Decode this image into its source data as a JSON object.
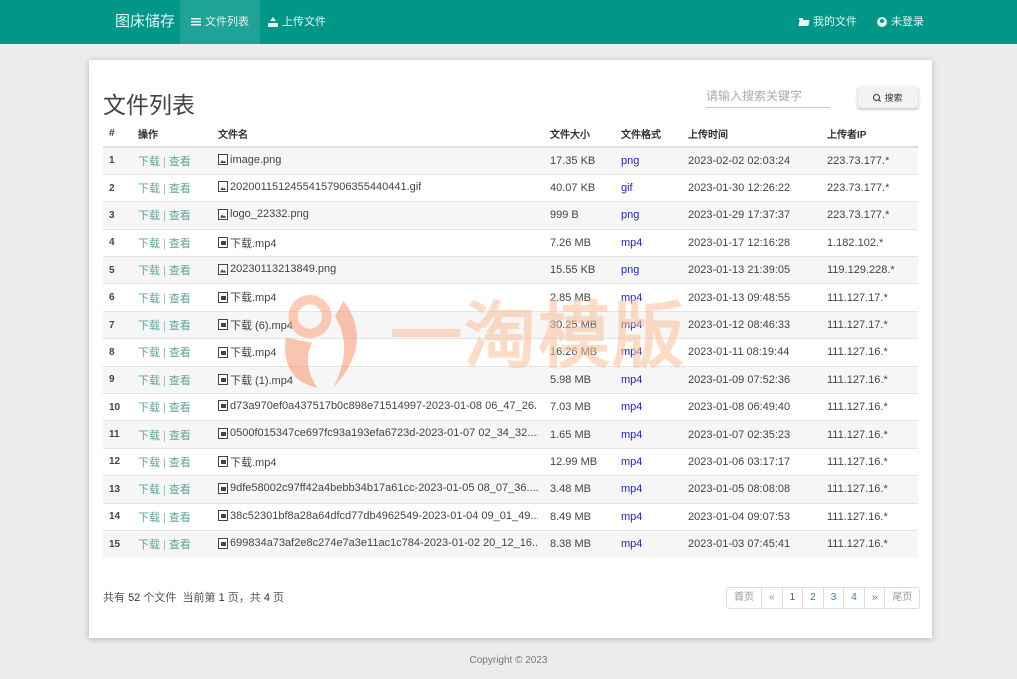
{
  "nav": {
    "brand": "图床储存",
    "items": [
      {
        "label": "文件列表",
        "icon": "list-icon",
        "active": true
      },
      {
        "label": "上传文件",
        "icon": "upload-icon",
        "active": false
      }
    ],
    "right": [
      {
        "label": "我的文件",
        "icon": "folder-open-icon"
      },
      {
        "label": "未登录",
        "icon": "user-circle-icon"
      }
    ]
  },
  "page": {
    "title": "文件列表",
    "search_placeholder": "请输入搜索关键字",
    "search_value": "",
    "search_button": "搜索"
  },
  "table": {
    "headers": [
      "#",
      "操作",
      "文件名",
      "文件大小",
      "文件格式",
      "上传时间",
      "上传者IP"
    ],
    "action_download": "下载",
    "action_separator": "|",
    "action_view": "查看",
    "rows": [
      {
        "n": "1",
        "name": "image.png",
        "kind": "image",
        "size": "17.35 KB",
        "fmt": "png",
        "time": "2023-02-02 02:03:24",
        "ip": "223.73.177.*"
      },
      {
        "n": "2",
        "name": "20200115124554157906355440441.gif",
        "kind": "image",
        "size": "40.07 KB",
        "fmt": "gif",
        "time": "2023-01-30 12:26:22",
        "ip": "223.73.177.*"
      },
      {
        "n": "3",
        "name": "logo_22332.png",
        "kind": "image",
        "size": "999 B",
        "fmt": "png",
        "time": "2023-01-29 17:37:37",
        "ip": "223.73.177.*"
      },
      {
        "n": "4",
        "name": "下载.mp4",
        "kind": "video",
        "size": "7.26 MB",
        "fmt": "mp4",
        "time": "2023-01-17 12:16:28",
        "ip": "1.182.102.*"
      },
      {
        "n": "5",
        "name": "20230113213849.png",
        "kind": "image",
        "size": "15.55 KB",
        "fmt": "png",
        "time": "2023-01-13 21:39:05",
        "ip": "119.129.228.*"
      },
      {
        "n": "6",
        "name": "下载.mp4",
        "kind": "video",
        "size": "2.85 MB",
        "fmt": "mp4",
        "time": "2023-01-13 09:48:55",
        "ip": "111.127.17.*"
      },
      {
        "n": "7",
        "name": "下载 (6).mp4",
        "kind": "video",
        "size": "30.25 MB",
        "fmt": "mp4",
        "time": "2023-01-12 08:46:33",
        "ip": "111.127.17.*"
      },
      {
        "n": "8",
        "name": "下载.mp4",
        "kind": "video",
        "size": "16.26 MB",
        "fmt": "mp4",
        "time": "2023-01-11 08:19:44",
        "ip": "111.127.16.*"
      },
      {
        "n": "9",
        "name": "下载 (1).mp4",
        "kind": "video",
        "size": "5.98 MB",
        "fmt": "mp4",
        "time": "2023-01-09 07:52:36",
        "ip": "111.127.16.*"
      },
      {
        "n": "10",
        "name": "d73a970ef0a437517b0c898e71514997-2023-01-08 06_47_26....",
        "kind": "video",
        "size": "7.03 MB",
        "fmt": "mp4",
        "time": "2023-01-08 06:49:40",
        "ip": "111.127.16.*"
      },
      {
        "n": "11",
        "name": "0500f015347ce697fc93a193efa6723d-2023-01-07 02_34_32....",
        "kind": "video",
        "size": "1.65 MB",
        "fmt": "mp4",
        "time": "2023-01-07 02:35:23",
        "ip": "111.127.16.*"
      },
      {
        "n": "12",
        "name": "下载.mp4",
        "kind": "video",
        "size": "12.99 MB",
        "fmt": "mp4",
        "time": "2023-01-06 03:17:17",
        "ip": "111.127.16.*"
      },
      {
        "n": "13",
        "name": "9dfe58002c97ff42a4bebb34b17a61cc-2023-01-05 08_07_36....",
        "kind": "video",
        "size": "3.48 MB",
        "fmt": "mp4",
        "time": "2023-01-05 08:08:08",
        "ip": "111.127.16.*"
      },
      {
        "n": "14",
        "name": "38c52301bf8a28a64dfcd77db4962549-2023-01-04 09_01_49....",
        "kind": "video",
        "size": "8.49 MB",
        "fmt": "mp4",
        "time": "2023-01-04 09:07:53",
        "ip": "111.127.16.*"
      },
      {
        "n": "15",
        "name": "699834a73af2e8c274e7a3e11ac1c784-2023-01-02 20_12_16....",
        "kind": "video",
        "size": "8.38 MB",
        "fmt": "mp4",
        "time": "2023-01-03 07:45:41",
        "ip": "111.127.16.*"
      }
    ]
  },
  "summary": {
    "prefix": "共有",
    "total_files": "52",
    "files_unit": "个文件",
    "current_prefix": "当前第",
    "current_page": "1",
    "current_suffix": "页，共",
    "total_pages": "4",
    "pages_suffix": "页"
  },
  "pagination": [
    "首页",
    "«",
    "1",
    "2",
    "3",
    "4",
    "»",
    "尾页"
  ],
  "watermark": "一淘模版",
  "footer": "Copyright © 2023",
  "colors": {
    "navbar": "#009688",
    "nav_active": "#1fa396",
    "action_link": "#5fa59a",
    "format_link": "#2222cc",
    "pager_link": "#337ab7"
  }
}
